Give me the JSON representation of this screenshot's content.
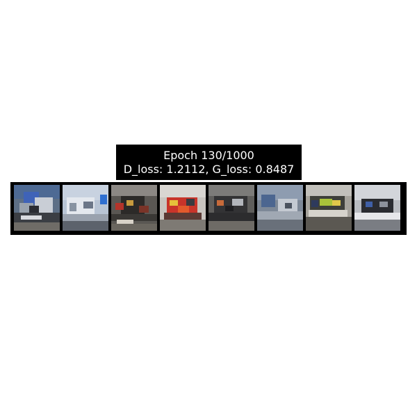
{
  "title": {
    "epoch_line": "Epoch 130/1000",
    "loss_line": "D_loss: 1.2112, G_loss: 0.8487"
  },
  "samples": [
    {
      "description": "generated sample 1"
    },
    {
      "description": "generated sample 2"
    },
    {
      "description": "generated sample 3"
    },
    {
      "description": "generated sample 4"
    },
    {
      "description": "generated sample 5"
    },
    {
      "description": "generated sample 6"
    },
    {
      "description": "generated sample 7"
    },
    {
      "description": "generated sample 8"
    }
  ]
}
